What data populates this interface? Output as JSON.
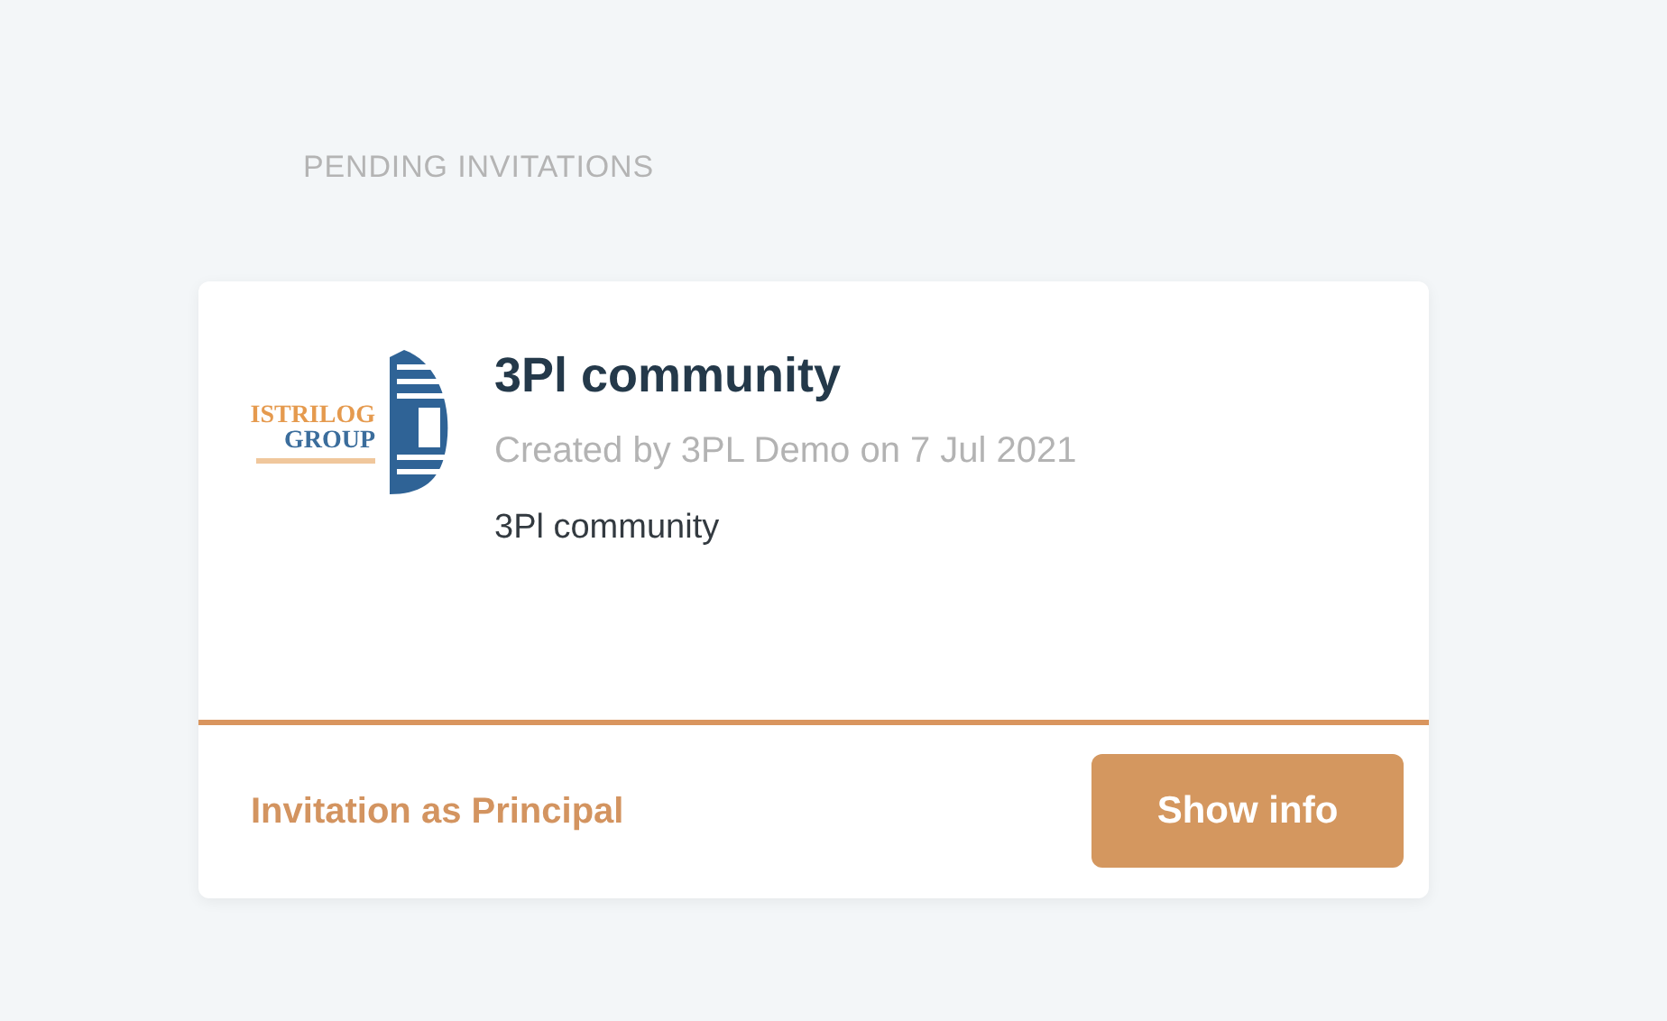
{
  "section_title": "PENDING INVITATIONS",
  "invitations": [
    {
      "logo": {
        "line_1": "ISTRILOG",
        "line_2": "GROUP"
      },
      "title": "3Pl community",
      "meta": "Created by 3PL Demo on 7 Jul 2021",
      "description": "3Pl community",
      "role": "Invitation as Principal",
      "button": "Show info"
    }
  ]
}
